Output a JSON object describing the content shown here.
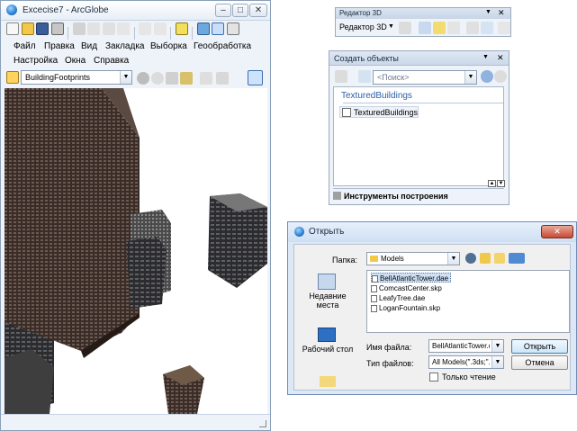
{
  "arcglobe": {
    "title": "Excecise7 - ArcGlobe",
    "menu": [
      "Файл",
      "Правка",
      "Вид",
      "Закладка",
      "Выборка",
      "Геообработка",
      "Настройка",
      "Окна",
      "Справка"
    ],
    "layer_combo_value": "BuildingFootprints",
    "window_buttons": {
      "minimize": "–",
      "maximize": "□",
      "close": "✕"
    }
  },
  "editor3d": {
    "title": "Редактор 3D",
    "menu_label": "Редактор 3D",
    "close": "✕",
    "menu_arrow": "▼"
  },
  "create_features": {
    "title": "Создать объекты",
    "search_placeholder": "<Поиск>",
    "group": "TexturedBuildings",
    "item": "TexturedBuildings",
    "tools_label": "Инструменты построения",
    "close": "✕",
    "menu_arrow": "▼"
  },
  "open_dialog": {
    "title": "Открыть",
    "folder_label": "Папка:",
    "folder_value": "Models",
    "places": [
      "Недавние места",
      "Рабочий стол"
    ],
    "files": [
      "BellAtlanticTower.dae",
      "ComcastCenter.skp",
      "LeafyTree.dae",
      "LoganFountain.skp"
    ],
    "filename_label": "Имя файла:",
    "filename_value": "BellAtlanticTower.da",
    "filetype_label": "Тип файлов:",
    "filetype_value": "All Models(\".3ds;\".flt;",
    "readonly_label": "Только чтение",
    "open_button": "Открыть",
    "cancel_button": "Отмена",
    "close": "✕"
  }
}
